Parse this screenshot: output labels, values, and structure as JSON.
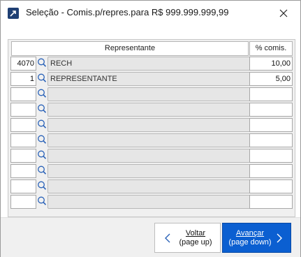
{
  "window": {
    "title": "Seleção - Comis.p/repres.para R$ 999.999.999,99"
  },
  "table": {
    "headers": {
      "representative": "Representante",
      "commission": "% comis."
    },
    "rows": [
      {
        "code": "4070",
        "name": "RECH",
        "commission": "10,00"
      },
      {
        "code": "1",
        "name": "REPRESENTANTE",
        "commission": "5,00"
      },
      {
        "code": "",
        "name": "",
        "commission": ""
      },
      {
        "code": "",
        "name": "",
        "commission": ""
      },
      {
        "code": "",
        "name": "",
        "commission": ""
      },
      {
        "code": "",
        "name": "",
        "commission": ""
      },
      {
        "code": "",
        "name": "",
        "commission": ""
      },
      {
        "code": "",
        "name": "",
        "commission": ""
      },
      {
        "code": "",
        "name": "",
        "commission": ""
      },
      {
        "code": "",
        "name": "",
        "commission": ""
      }
    ]
  },
  "buttons": {
    "back": {
      "line1": "Voltar",
      "line2": "(page up)"
    },
    "next": {
      "line1": "Avançar",
      "line2": "(page down)"
    }
  },
  "colors": {
    "accent": "#0b5fd1",
    "lookup_icon": "#2a62b8"
  },
  "icons": {
    "app": "app-shortcut-icon",
    "close": "close-icon",
    "lookup": "search-icon",
    "back": "chevron-left-icon",
    "next": "chevron-right-icon"
  }
}
